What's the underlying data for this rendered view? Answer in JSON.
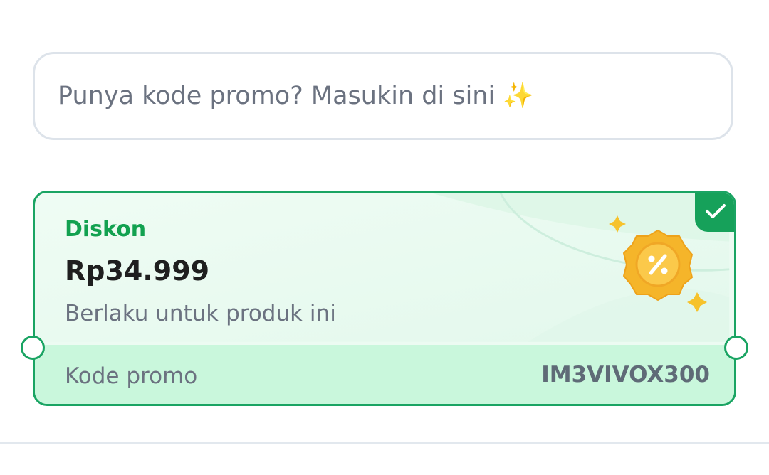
{
  "promo_input": {
    "placeholder": "Punya kode promo? Masukin di sini ✨"
  },
  "voucher": {
    "label": "Diskon",
    "amount": "Rp34.999",
    "description": "Berlaku untuk produk ini",
    "code_label": "Kode promo",
    "code_value": "IM3VIVOX300",
    "selected": true,
    "icons": {
      "selected": "checkmark-icon",
      "badge": "percent-badge-icon",
      "sparkle": "sparkle-icon"
    }
  },
  "colors": {
    "accent_green": "#12a150",
    "border_green": "#1aa463",
    "voucher_bg": "#ecfbf2",
    "voucher_bottom_bg": "#c9f7dc",
    "text_muted": "#6b7280",
    "badge_gold": "#f5b52a"
  }
}
